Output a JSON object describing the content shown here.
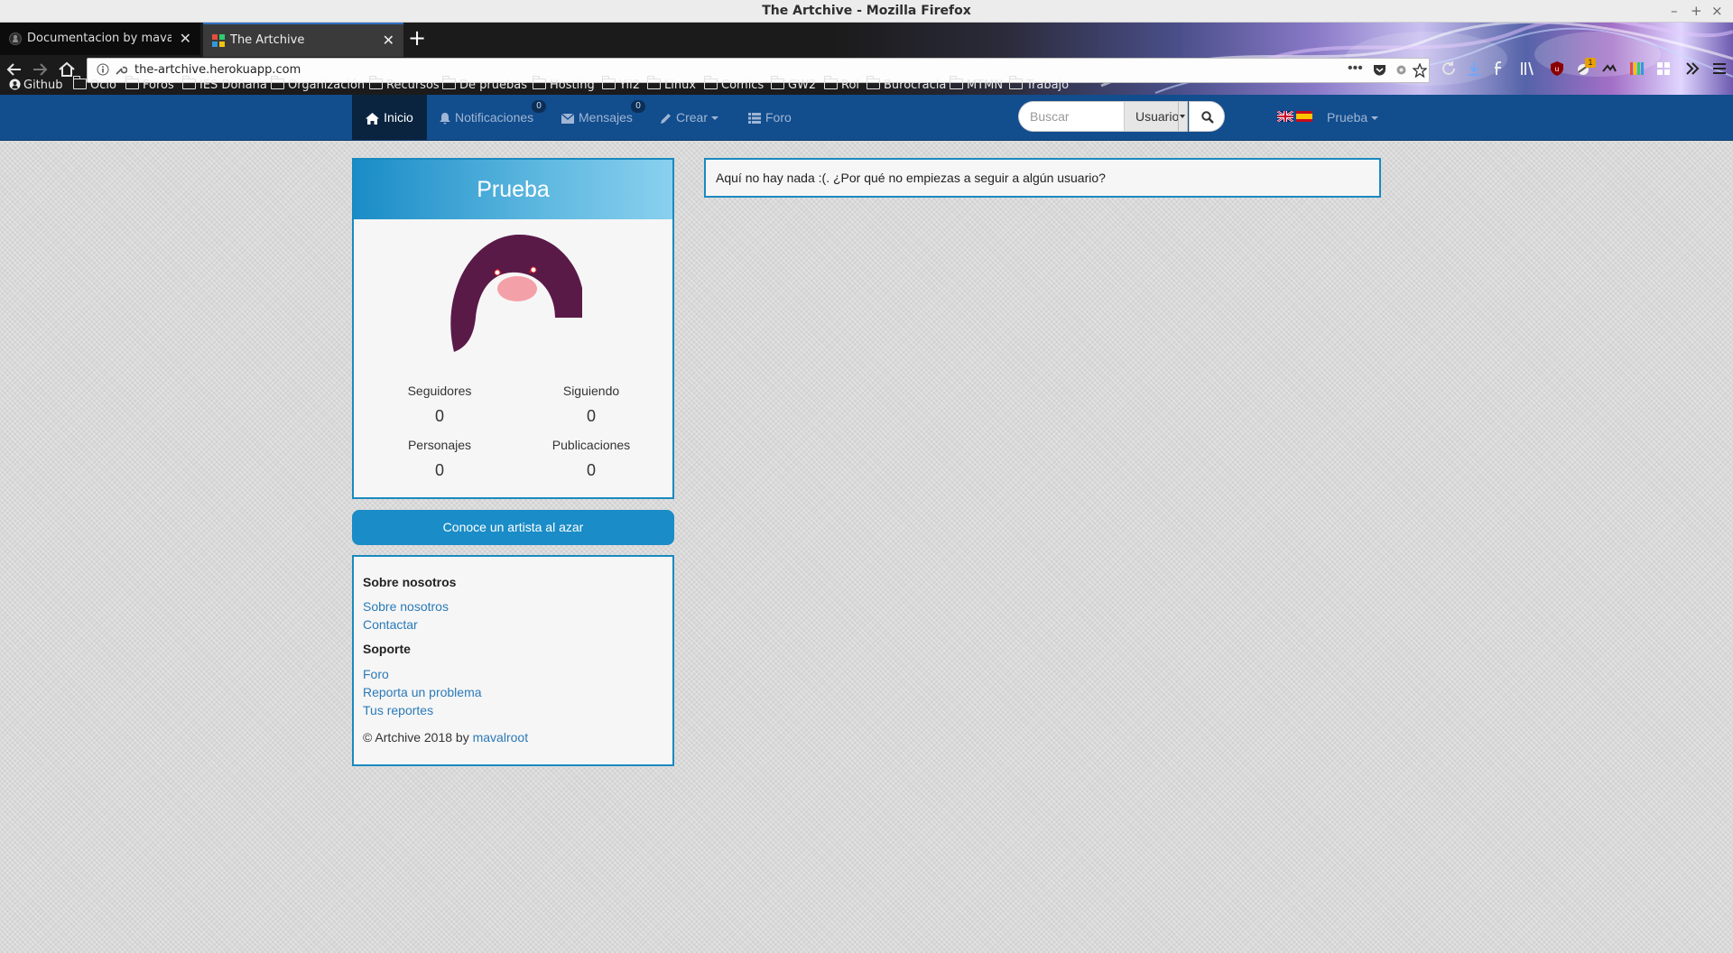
{
  "window": {
    "title": "The Artchive - Mozilla Firefox",
    "controls": [
      "–",
      "+",
      "×"
    ]
  },
  "browser": {
    "tabs": [
      {
        "label": "Documentacion by mavalroot",
        "favicon": "github-icon"
      },
      {
        "label": "The Artchive",
        "favicon": "artchive-icon"
      }
    ],
    "new_tab_label": "+",
    "url": "the-artchive.herokuapp.com",
    "bookmarks": [
      "Github",
      "Ocio",
      "Foros",
      "IES Doñana",
      "Organización",
      "Recursos",
      "De pruebas",
      "Hosting",
      "Yii2",
      "Linux",
      "Comics",
      "GW2",
      "Rol",
      "Burocracia",
      "MTMN",
      "Trabajo"
    ],
    "toolbar_badges": {
      "addon_badge": "1"
    }
  },
  "site_nav": {
    "items": [
      {
        "label": "Inicio",
        "icon": "home-icon",
        "active": true
      },
      {
        "label": "Notificaciones",
        "icon": "bell-icon",
        "badge": "0"
      },
      {
        "label": "Mensajes",
        "icon": "envelope-icon",
        "badge": "0"
      },
      {
        "label": "Crear",
        "icon": "pencil-icon",
        "dropdown": true
      },
      {
        "label": "Foro",
        "icon": "list-icon"
      }
    ],
    "search": {
      "placeholder": "Buscar",
      "type_selected": "Usuario"
    },
    "languages": [
      "en-flag-icon",
      "es-flag-icon"
    ],
    "user_menu": "Prueba"
  },
  "profile": {
    "username": "Prueba",
    "stats": [
      {
        "label": "Seguidores",
        "value": "0"
      },
      {
        "label": "Siguiendo",
        "value": "0"
      },
      {
        "label": "Personajes",
        "value": "0"
      },
      {
        "label": "Publicaciones",
        "value": "0"
      }
    ]
  },
  "random_artist_button": "Conoce un artista al azar",
  "footer": {
    "about_heading": "Sobre nosotros",
    "about_links": [
      "Sobre nosotros",
      "Contactar"
    ],
    "support_heading": "Soporte",
    "support_links": [
      "Foro",
      "Reporta un problema",
      "Tus reportes"
    ],
    "copyright": "© Artchive 2018 by ",
    "author": "mavalroot"
  },
  "feed": {
    "empty_message": "Aquí no hay nada :(. ¿Por qué no empiezas a seguir a algún usuario?"
  },
  "colors": {
    "navbar": "#124d8d",
    "navbar_active": "#0a2440",
    "accent": "#1a8cc7",
    "link": "#2a7ab8"
  }
}
